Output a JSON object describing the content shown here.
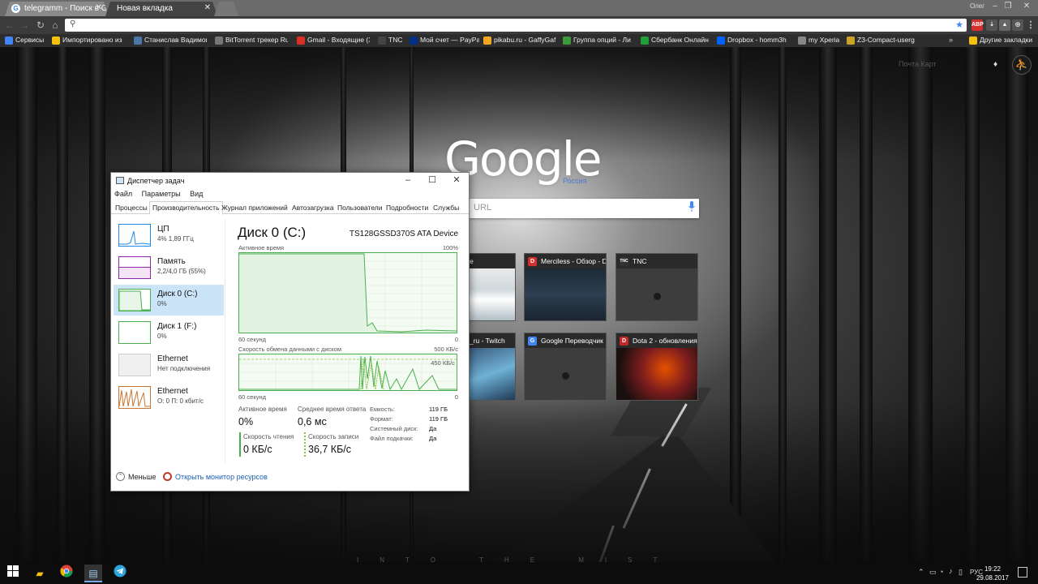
{
  "browser": {
    "tabs": [
      {
        "label": "telegramm - Поиск в Goo"
      },
      {
        "label": "Новая вкладка"
      }
    ],
    "profile_label": "Олег",
    "bookmarks": [
      {
        "label": "Сервисы",
        "color": "#4285f4"
      },
      {
        "label": "Импортировано из",
        "color": "#f4c20d"
      },
      {
        "label": "Станислав Вадимов",
        "color": "#4a76a8"
      },
      {
        "label": "BitTorrent трекер Ru",
        "color": "#777777"
      },
      {
        "label": "Gmail - Входящие (3",
        "color": "#d93025"
      },
      {
        "label": "TNC",
        "color": "#444444"
      },
      {
        "label": "Мой счет — PayPal",
        "color": "#003087"
      },
      {
        "label": "pikabu.ru - GaffyGaf",
        "color": "#f5a623"
      },
      {
        "label": "Группа опций - Ли",
        "color": "#3c9a3c"
      },
      {
        "label": "Сбербанк Онлайн",
        "color": "#21a038"
      },
      {
        "label": "Dropbox - homm3h",
        "color": "#0061ff"
      },
      {
        "label": "my Xperia",
        "color": "#888888"
      },
      {
        "label": "Z3-Compact-userg",
        "color": "#c9a227"
      },
      {
        "label": "Другие закладки",
        "color": "#f4c20d"
      }
    ]
  },
  "ntp": {
    "logo": "Google",
    "logo_sub": "Россия",
    "search_placeholder": "URL",
    "top_links": "Почта  Карт",
    "tiles": [
      {
        "title": "e",
        "favicon": "",
        "fav_color": "#555555"
      },
      {
        "title": "Merciless - Обзор - D",
        "favicon": "D",
        "fav_color": "#d32f2f"
      },
      {
        "title": "TNC",
        "favicon": "TNC",
        "fav_color": "#333333"
      },
      {
        "title": "_ru - Twitch",
        "favicon": "",
        "fav_color": "#6441a4"
      },
      {
        "title": "Google Переводчик",
        "favicon": "G",
        "fav_color": "#4285f4"
      },
      {
        "title": "Dota 2 - обновления",
        "favicon": "D",
        "fav_color": "#c62828"
      }
    ],
    "brand": "INTO THE MIST"
  },
  "taskmgr": {
    "title": "Диспетчер задач",
    "menu": [
      "Файл",
      "Параметры",
      "Вид"
    ],
    "tabs": [
      "Процессы",
      "Производительность",
      "Журнал приложений",
      "Автозагрузка",
      "Пользователи",
      "Подробности",
      "Службы"
    ],
    "resources": [
      {
        "name": "ЦП",
        "sub": "4% 1,89 ГГц",
        "color": "#1e88e5"
      },
      {
        "name": "Память",
        "sub": "2,2/4,0 ГБ (55%)",
        "color": "#8e24aa"
      },
      {
        "name": "Диск 0 (C:)",
        "sub": "0%",
        "color": "#4caf50"
      },
      {
        "name": "Диск 1 (F:)",
        "sub": "0%",
        "color": "#4caf50"
      },
      {
        "name": "Ethernet",
        "sub": "Нет подключения",
        "color": "#bdbdbd"
      },
      {
        "name": "Ethernet",
        "sub": "О: 0 П: 0 кбит/с",
        "color": "#c87533"
      }
    ],
    "detail": {
      "title": "Диск 0 (C:)",
      "model": "TS128GSSD370S ATA Device",
      "active_label": "Активное время",
      "active_max": "100%",
      "axis_left": "60 секунд",
      "axis_right": "0",
      "transfer_label": "Скорость обмена данными с диском",
      "transfer_max": "500 КБ/с",
      "transfer_mark": "450 КБ/с",
      "active_time_title": "Активное время",
      "active_time_value": "0%",
      "avg_response_title": "Среднее время ответа",
      "avg_response_value": "0,6 мс",
      "read_speed_title": "Скорость чтения",
      "read_speed_value": "0 КБ/с",
      "write_speed_title": "Скорость записи",
      "write_speed_value": "36,7 КБ/с",
      "props": [
        {
          "label": "Емкость:",
          "value": "119 ГБ"
        },
        {
          "label": "Формат:",
          "value": "119 ГБ"
        },
        {
          "label": "Системный диск:",
          "value": "Да"
        },
        {
          "label": "Файл подкачки:",
          "value": "Да"
        }
      ]
    },
    "footer_less": "Меньше",
    "footer_monitor": "Открыть монитор ресурсов"
  },
  "taskbar": {
    "lang": "РУС",
    "time": "19:22",
    "date": "29.08.2017"
  }
}
